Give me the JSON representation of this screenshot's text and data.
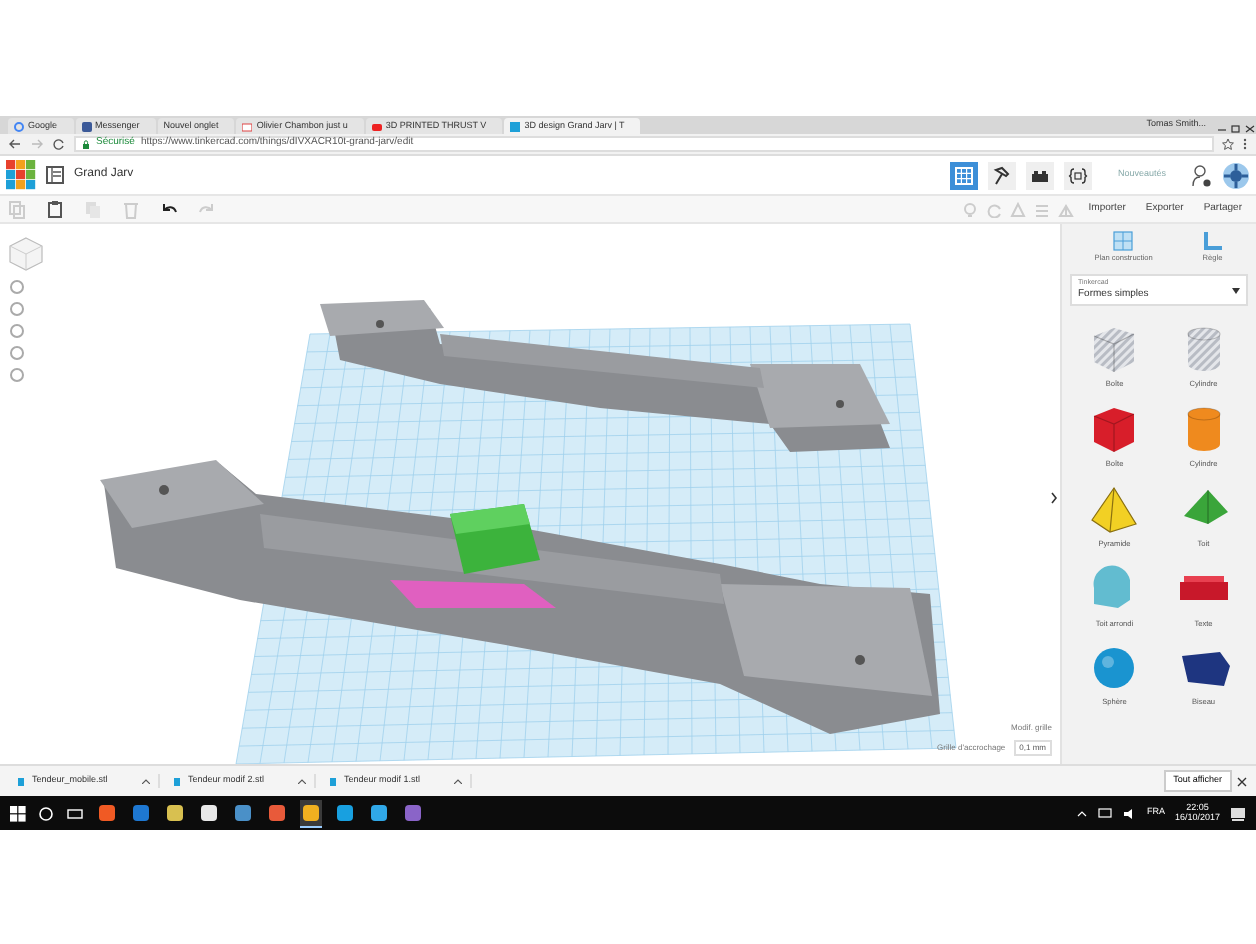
{
  "browser": {
    "tabs": [
      {
        "label": "Google",
        "kind": "google",
        "selected": false
      },
      {
        "label": "Messenger",
        "kind": "facebook",
        "selected": false
      },
      {
        "label": "Nouvel onglet",
        "kind": "blank",
        "selected": false
      },
      {
        "label": "Olivier Chambon just u",
        "kind": "mail",
        "selected": false
      },
      {
        "label": "3D PRINTED THRUST V",
        "kind": "video",
        "selected": false
      },
      {
        "label": "3D design Grand Jarv | T",
        "kind": "tinkercad",
        "selected": true
      }
    ],
    "window_user": "Tomas Smith...",
    "secure_label": "Sécurisé",
    "url": "https://www.tinkercad.com/things/dIVXACR10t-grand-jarv/edit"
  },
  "app": {
    "title": "Grand Jarv",
    "news": "Nouveautés",
    "views": [
      {
        "kind": "grid",
        "selected": true
      },
      {
        "kind": "hammer",
        "selected": false
      },
      {
        "kind": "bricks",
        "selected": false
      },
      {
        "kind": "code",
        "selected": false
      }
    ]
  },
  "toolbar": {
    "actions": [
      "Importer",
      "Exporter",
      "Partager"
    ]
  },
  "panel": {
    "tools": [
      {
        "kind": "workplane",
        "label": "Plan construction"
      },
      {
        "kind": "ruler",
        "label": "Règle"
      }
    ],
    "library_label": "Tinkercad",
    "library": "Formes simples",
    "shapes": [
      {
        "kind": "box",
        "label": "Boîte",
        "color": "#b8bcc4"
      },
      {
        "kind": "cylinder",
        "label": "Cylindre",
        "color": "#b8bcc4"
      },
      {
        "kind": "box",
        "label": "Boîte",
        "color": "#d81e2a"
      },
      {
        "kind": "cylinder",
        "label": "Cylindre",
        "color": "#ef8a1e"
      },
      {
        "kind": "pyramid",
        "label": "Pyramide",
        "color": "#f2d024"
      },
      {
        "kind": "roof",
        "label": "Toit",
        "color": "#3aa53a"
      },
      {
        "kind": "round-roof",
        "label": "Toit arrondi",
        "color": "#62bcd0"
      },
      {
        "kind": "text",
        "label": "Texte",
        "color": "#c8182a"
      },
      {
        "kind": "sphere",
        "label": "Sphère",
        "color": "#1a94d0"
      },
      {
        "kind": "wedge",
        "label": "Biseau",
        "color": "#1e3580"
      }
    ]
  },
  "grid": {
    "edit_label": "Modif. grille",
    "snap_label": "Grille d'accrochage",
    "snap_value": "0,1 mm"
  },
  "downloads": {
    "files": [
      "Tendeur_mobile.stl",
      "Tendeur modif 2.stl",
      "Tendeur modif 1.stl"
    ],
    "show_all": "Tout afficher"
  },
  "taskbar": {
    "apps": [
      {
        "color": "#f05a24",
        "selected": false
      },
      {
        "color": "#1e78d2",
        "selected": false
      },
      {
        "color": "#d8c050",
        "selected": false
      },
      {
        "color": "#e8e8e8",
        "selected": false
      },
      {
        "color": "#4a90c8",
        "selected": false
      },
      {
        "color": "#e85a3a",
        "selected": false
      },
      {
        "color": "#f0b020",
        "selected": true
      },
      {
        "color": "#18a0e0",
        "selected": false
      },
      {
        "color": "#30a8e8",
        "selected": false
      },
      {
        "color": "#8a64c8",
        "selected": false
      }
    ],
    "language": "FRA",
    "time": "22:05",
    "date": "16/10/2017"
  }
}
